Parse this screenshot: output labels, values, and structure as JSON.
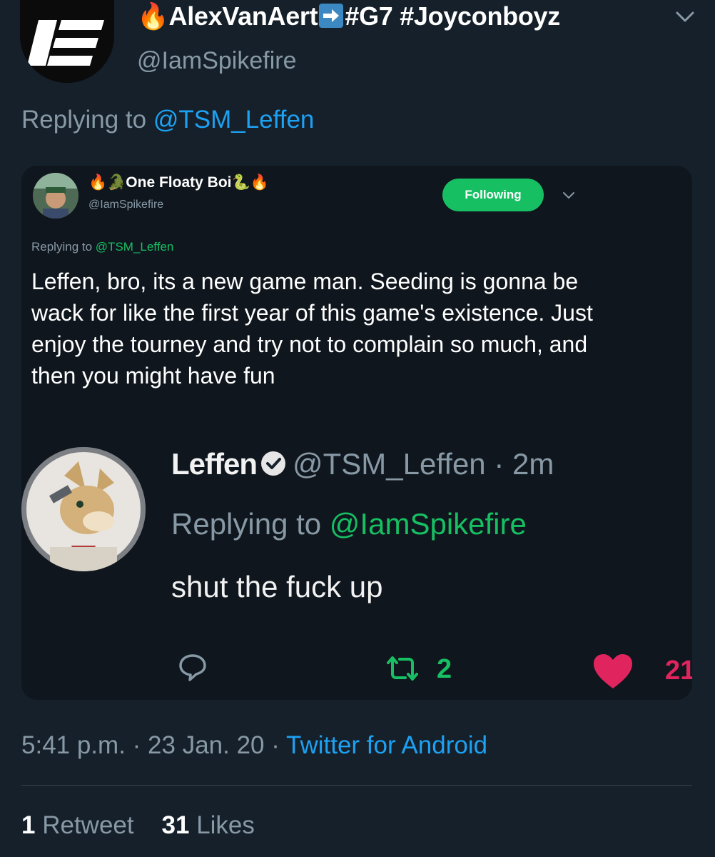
{
  "tweet": {
    "display_name": {
      "prefix_emoji": "🔥",
      "name": "AlexVanAert",
      "arrow_emoji": "➡",
      "suffix": "#G7 #Joyconboyz"
    },
    "handle": "@IamSpikefire",
    "replying_prefix": "Replying to",
    "replying_to": "@TSM_Leffen",
    "time": "5:41 p.m.",
    "separator": "·",
    "date": "23 Jan. 20",
    "source": "Twitter for Android",
    "retweet_count": "1",
    "retweet_label": "Retweet",
    "like_count": "31",
    "like_label": "Likes",
    "icons": {
      "menu": "chevron-down-icon",
      "avatar": "logo-avatar"
    }
  },
  "embedded": {
    "name": "One Floaty Boi",
    "name_emojis_before": "🔥🐊",
    "name_emojis_after": "🐍🔥",
    "handle": "@IamSpikefire",
    "follow_button": "Following",
    "replying_prefix": "Replying to",
    "replying_to": "@TSM_Leffen",
    "body": "Leffen, bro, its a new game man. Seeding is gonna be wack for like the first year of this game's existence. Just enjoy the tourney and try not to complain so much, and then you might have fun",
    "quoted": {
      "name": "Leffen",
      "handle": "@TSM_Leffen",
      "separator": "·",
      "age": "2m",
      "replying_prefix": "Replying to",
      "replying_to": "@IamSpikefire",
      "text": "shut the fuck up"
    },
    "actions": {
      "retweets": "2",
      "likes": "21"
    }
  },
  "colors": {
    "background": "#15202b",
    "card": "#0f161d",
    "link_blue": "#1da1f2",
    "link_green": "#17bf63",
    "like_red": "#e0245e",
    "muted": "#8899a6"
  }
}
